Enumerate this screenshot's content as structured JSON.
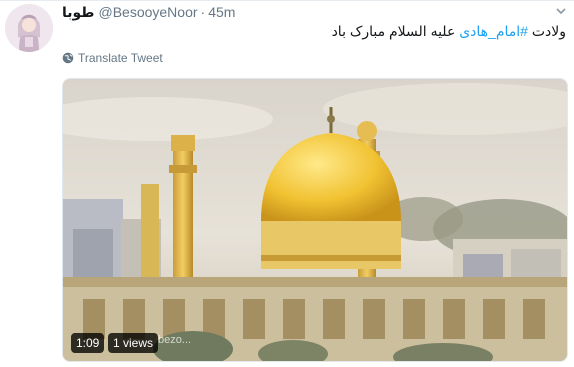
{
  "tweet": {
    "display_name": "طوبا",
    "handle": "@BesooyeNoor",
    "separator": "·",
    "time": "45m",
    "text_before": "ولادت ",
    "hashtag": "#امام_هادی",
    "text_after": " علیه السلام مبارک باد",
    "translate_label": "Translate Tweet"
  },
  "video": {
    "duration": "1:09",
    "views": "1 views",
    "watermark": "/bezo..."
  },
  "icons": {
    "avatar": "avatar-girl-illustration",
    "translate": "globe-icon",
    "menu": "chevron-down-icon"
  },
  "colors": {
    "link": "#1da1f2",
    "muted": "#657786",
    "text": "#14171a"
  }
}
